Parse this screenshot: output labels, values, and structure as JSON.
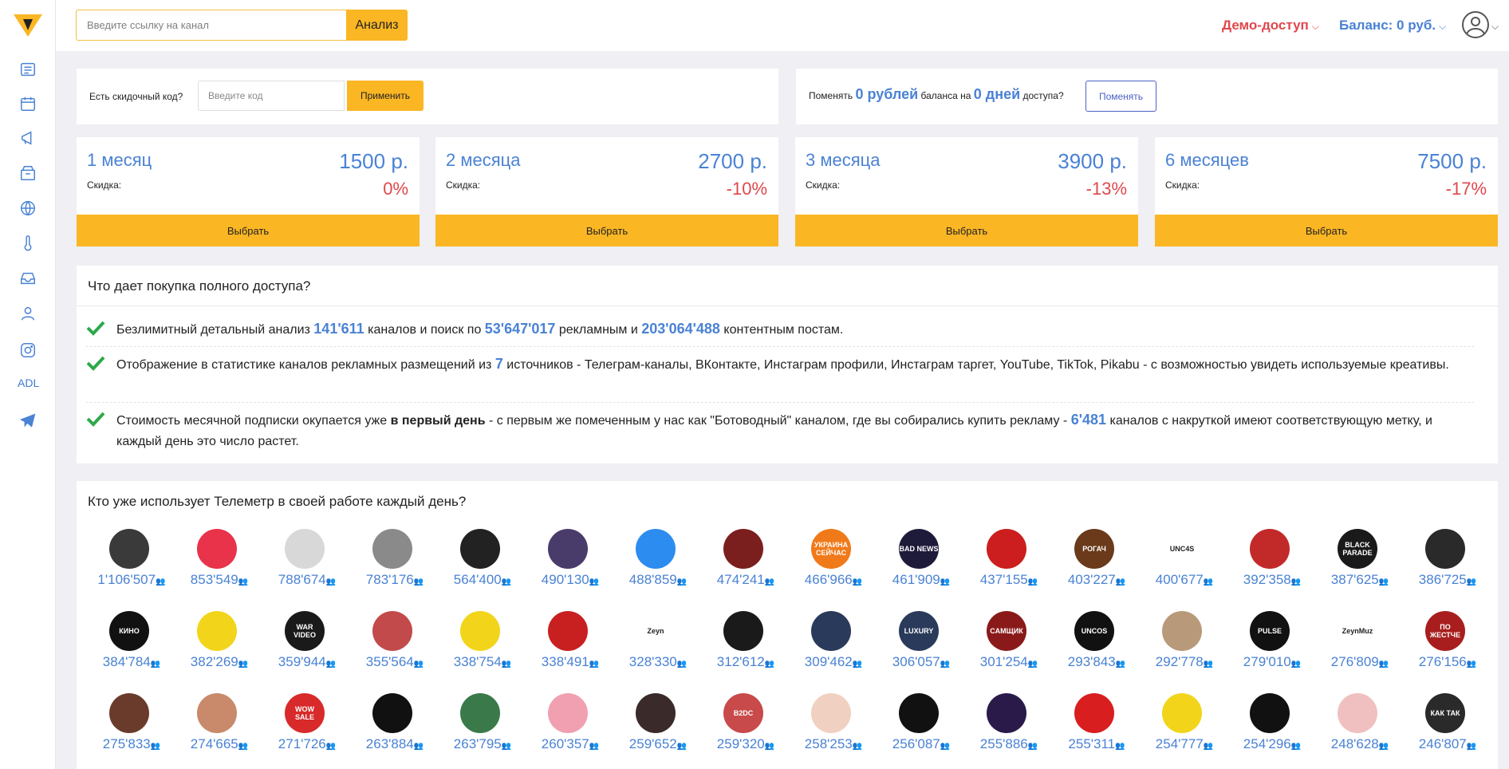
{
  "header": {
    "search_placeholder": "Введите ссылку на канал",
    "analyze_label": "Анализ",
    "demo_access": "Демо-доступ",
    "balance": "Баланс: 0 руб."
  },
  "sidebar": {
    "adl_label": "ADL",
    "icons": [
      "list-icon",
      "calendar-icon",
      "megaphone-icon",
      "archive-icon",
      "globe-icon",
      "thermometer-icon",
      "inbox-icon",
      "users-icon",
      "instagram-icon",
      "telegram-icon"
    ]
  },
  "promo": {
    "label": "Есть скидочный код?",
    "placeholder": "Введите код",
    "apply_label": "Применить"
  },
  "exchange": {
    "prefix": "Поменять",
    "amount": "0 рублей",
    "middle": "баланса на",
    "days": "0 дней",
    "suffix": "доступа?",
    "button": "Поменять"
  },
  "plans": [
    {
      "name": "1 месяц",
      "price": "1500 р.",
      "discount_label": "Скидка:",
      "discount": "0%",
      "button": "Выбрать"
    },
    {
      "name": "2 месяца",
      "price": "2700 р.",
      "discount_label": "Скидка:",
      "discount": "-10%",
      "button": "Выбрать"
    },
    {
      "name": "3 месяца",
      "price": "3900 р.",
      "discount_label": "Скидка:",
      "discount": "-13%",
      "button": "Выбрать"
    },
    {
      "name": "6 месяцев",
      "price": "7500 р.",
      "discount_label": "Скидка:",
      "discount": "-17%",
      "button": "Выбрать"
    }
  ],
  "benefits": {
    "title": "Что дает покупка полного доступа?",
    "items": [
      {
        "t1": "Безлимитный детальный анализ ",
        "n1": "141'611",
        "t2": " каналов и поиск по ",
        "n2": "53'647'017",
        "t3": " рекламным и ",
        "n3": "203'064'488",
        "t4": " контентным постам."
      },
      {
        "t1": "Отображение в статистике каналов рекламных размещений из ",
        "n1": "7",
        "t2": " источников - Телеграм-каналы, ВКонтакте, Инстаграм профили, Инстаграм таргет, YouTube, TikTok, Pikabu - с возможностью увидеть используемые креативы."
      },
      {
        "t1": "Стоимость месячной подписки окупается уже ",
        "bold": "в первый день",
        "t2": " - с первым же помеченным у нас как \"Ботоводный\" каналом, где вы собирались купить рекламу - ",
        "n1": "6'481",
        "t3": " каналов с накруткой имеют соответствующую метку, и каждый день это число растет."
      }
    ]
  },
  "users": {
    "title": "Кто уже использует Телеметр в своей работе каждый день?",
    "rows": [
      [
        {
          "count": "1'106'507",
          "color": "#3a3a3a",
          "label": ""
        },
        {
          "count": "853'549",
          "color": "#e8334a",
          "label": ""
        },
        {
          "count": "788'674",
          "color": "#d8d8d8",
          "label": ""
        },
        {
          "count": "783'176",
          "color": "#8a8a8a",
          "label": ""
        },
        {
          "count": "564'400",
          "color": "#222222",
          "label": ""
        },
        {
          "count": "490'130",
          "color": "#4a3c6a",
          "label": ""
        },
        {
          "count": "488'859",
          "color": "#2d8cf0",
          "label": ""
        },
        {
          "count": "474'241",
          "color": "#7a1e1e",
          "label": ""
        },
        {
          "count": "466'966",
          "color": "#f07a1a",
          "label": "УКРАИНА СЕЙЧАС"
        },
        {
          "count": "461'909",
          "color": "#1e1a3a",
          "label": "BAD NEWS"
        },
        {
          "count": "437'155",
          "color": "#cc1e1e",
          "label": ""
        },
        {
          "count": "403'227",
          "color": "#6a3a1a",
          "label": "РОГАЧ"
        },
        {
          "count": "400'677",
          "color": "#ffffff",
          "label": "UNC4S"
        },
        {
          "count": "392'358",
          "color": "#c22a2a",
          "label": ""
        },
        {
          "count": "387'625",
          "color": "#1a1a1a",
          "label": "BLACK PARADE"
        },
        {
          "count": "386'725",
          "color": "#2a2a2a",
          "label": ""
        }
      ],
      [
        {
          "count": "384'784",
          "color": "#111111",
          "label": "КИНО"
        },
        {
          "count": "382'269",
          "color": "#f2d51a",
          "label": ""
        },
        {
          "count": "359'944",
          "color": "#1a1a1a",
          "label": "WAR VIDEO"
        },
        {
          "count": "355'564",
          "color": "#c24a4a",
          "label": ""
        },
        {
          "count": "338'754",
          "color": "#f2d51a",
          "label": ""
        },
        {
          "count": "338'491",
          "color": "#c82020",
          "label": ""
        },
        {
          "count": "328'330",
          "color": "#ffffff",
          "label": "Zeyn"
        },
        {
          "count": "312'612",
          "color": "#1a1a1a",
          "label": ""
        },
        {
          "count": "309'462",
          "color": "#2a3a5a",
          "label": ""
        },
        {
          "count": "306'057",
          "color": "#2a3a5a",
          "label": "LUXURY"
        },
        {
          "count": "301'254",
          "color": "#8a1a1a",
          "label": "САМЩИК"
        },
        {
          "count": "293'843",
          "color": "#111111",
          "label": "UNCOS"
        },
        {
          "count": "292'778",
          "color": "#b89a7a",
          "label": ""
        },
        {
          "count": "279'010",
          "color": "#111111",
          "label": "PULSE"
        },
        {
          "count": "276'809",
          "color": "#ffffff",
          "label": "ZeynMuz"
        },
        {
          "count": "276'156",
          "color": "#a81e1e",
          "label": "ПО ЖЕСТЧЕ"
        }
      ],
      [
        {
          "count": "275'833",
          "color": "#6a3a2a",
          "label": ""
        },
        {
          "count": "274'665",
          "color": "#c88a6a",
          "label": ""
        },
        {
          "count": "271'726",
          "color": "#d82a2a",
          "label": "WOW SALE"
        },
        {
          "count": "263'884",
          "color": "#111111",
          "label": ""
        },
        {
          "count": "263'795",
          "color": "#3a7a4a",
          "label": ""
        },
        {
          "count": "260'357",
          "color": "#f0a0b0",
          "label": ""
        },
        {
          "count": "259'652",
          "color": "#3a2a2a",
          "label": ""
        },
        {
          "count": "259'320",
          "color": "#c84a4a",
          "label": "B2DC"
        },
        {
          "count": "258'253",
          "color": "#f0d0c0",
          "label": ""
        },
        {
          "count": "256'087",
          "color": "#111111",
          "label": ""
        },
        {
          "count": "255'886",
          "color": "#2a1a4a",
          "label": ""
        },
        {
          "count": "255'311",
          "color": "#d81e1e",
          "label": ""
        },
        {
          "count": "254'777",
          "color": "#f2d51a",
          "label": ""
        },
        {
          "count": "254'296",
          "color": "#111111",
          "label": ""
        },
        {
          "count": "248'628",
          "color": "#f0c0c0",
          "label": ""
        },
        {
          "count": "246'807",
          "color": "#2a2a2a",
          "label": "КАК ТАК"
        }
      ]
    ]
  }
}
